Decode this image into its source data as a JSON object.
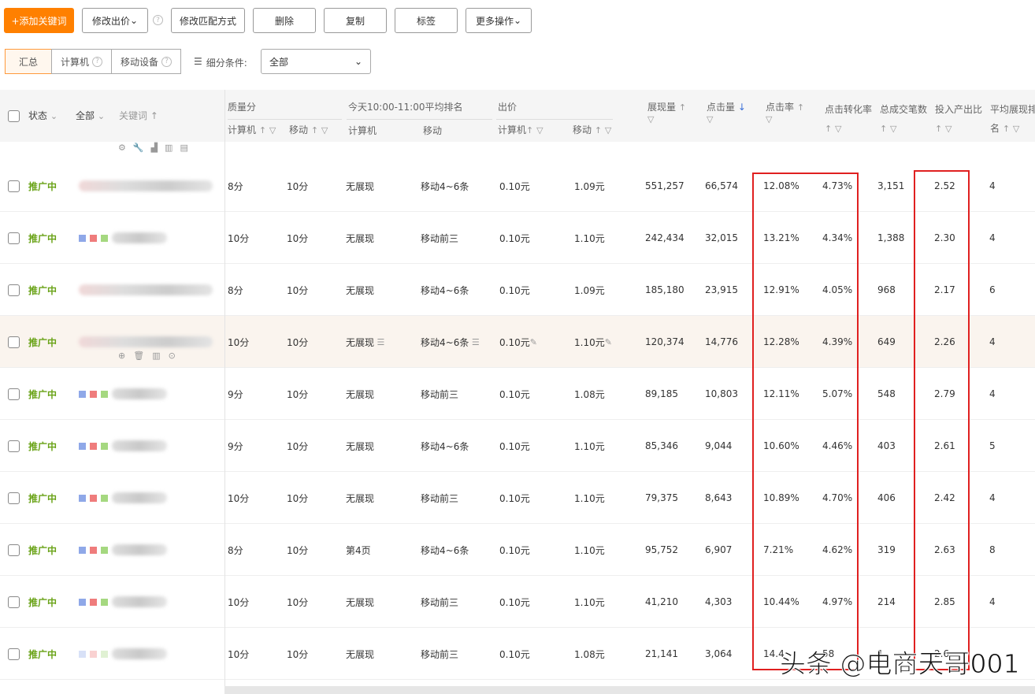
{
  "toolbar": {
    "add": "+添加关键词",
    "edit_bid": "修改出价",
    "edit_match": "修改匹配方式",
    "delete": "删除",
    "copy": "复制",
    "tag": "标签",
    "more": "更多操作"
  },
  "segments": {
    "summary": "汇总",
    "pc": "计算机",
    "mobile": "移动设备",
    "filter_label": "细分条件:",
    "filter_value": "全部"
  },
  "header": {
    "status": "状态",
    "all": "全部",
    "keyword": "关键词",
    "quality": "质量分",
    "qs_pc": "计算机",
    "qs_mobile": "移动",
    "rank": "今天10:00-11:00平均排名",
    "rank_pc": "计算机",
    "rank_mobile": "移动",
    "bid": "出价",
    "bid_pc": "计算机",
    "bid_mobile": "移动",
    "impressions": "展现量",
    "clicks": "点击量",
    "ctr": "点击率",
    "cvr": "点击转化率",
    "orders": "总成交笔数",
    "roi": "投入产出比",
    "avg_rank_1": "平均展现排",
    "avg_rank_2": "名"
  },
  "colors": {
    "accent": "#ff8000",
    "status": "#6aa318",
    "highlight": "#e02020"
  },
  "rows": [
    {
      "status": "推广中",
      "kw": "gray",
      "qs_pc": "8分",
      "qs_m": "10分",
      "rank_pc": "无展现",
      "rank_m": "移动4~6条",
      "bid_pc": "0.10元",
      "bid_m": "1.09元",
      "impr": "551,257",
      "clicks": "66,574",
      "ctr": "12.08%",
      "cvr": "4.73%",
      "orders": "3,151",
      "roi": "2.52",
      "avg": "4"
    },
    {
      "status": "推广中",
      "kw": "color",
      "qs_pc": "10分",
      "qs_m": "10分",
      "rank_pc": "无展现",
      "rank_m": "移动前三",
      "bid_pc": "0.10元",
      "bid_m": "1.10元",
      "impr": "242,434",
      "clicks": "32,015",
      "ctr": "13.21%",
      "cvr": "4.34%",
      "orders": "1,388",
      "roi": "2.30",
      "avg": "4"
    },
    {
      "status": "推广中",
      "kw": "gray",
      "qs_pc": "8分",
      "qs_m": "10分",
      "rank_pc": "无展现",
      "rank_m": "移动4~6条",
      "bid_pc": "0.10元",
      "bid_m": "1.09元",
      "impr": "185,180",
      "clicks": "23,915",
      "ctr": "12.91%",
      "cvr": "4.05%",
      "orders": "968",
      "roi": "2.17",
      "avg": "6"
    },
    {
      "status": "推广中",
      "kw": "gray",
      "hover": true,
      "qs_pc": "10分",
      "qs_m": "10分",
      "rank_pc": "无展现",
      "rank_m": "移动4~6条",
      "bid_pc": "0.10元",
      "bid_m": "1.10元",
      "impr": "120,374",
      "clicks": "14,776",
      "ctr": "12.28%",
      "cvr": "4.39%",
      "orders": "649",
      "roi": "2.26",
      "avg": "4"
    },
    {
      "status": "推广中",
      "kw": "color",
      "qs_pc": "9分",
      "qs_m": "10分",
      "rank_pc": "无展现",
      "rank_m": "移动前三",
      "bid_pc": "0.10元",
      "bid_m": "1.08元",
      "impr": "89,185",
      "clicks": "10,803",
      "ctr": "12.11%",
      "cvr": "5.07%",
      "orders": "548",
      "roi": "2.79",
      "avg": "4"
    },
    {
      "status": "推广中",
      "kw": "color",
      "qs_pc": "9分",
      "qs_m": "10分",
      "rank_pc": "无展现",
      "rank_m": "移动4~6条",
      "bid_pc": "0.10元",
      "bid_m": "1.10元",
      "impr": "85,346",
      "clicks": "9,044",
      "ctr": "10.60%",
      "cvr": "4.46%",
      "orders": "403",
      "roi": "2.61",
      "avg": "5"
    },
    {
      "status": "推广中",
      "kw": "color",
      "qs_pc": "10分",
      "qs_m": "10分",
      "rank_pc": "无展现",
      "rank_m": "移动前三",
      "bid_pc": "0.10元",
      "bid_m": "1.10元",
      "impr": "79,375",
      "clicks": "8,643",
      "ctr": "10.89%",
      "cvr": "4.70%",
      "orders": "406",
      "roi": "2.42",
      "avg": "4"
    },
    {
      "status": "推广中",
      "kw": "color",
      "qs_pc": "8分",
      "qs_m": "10分",
      "rank_pc": "第4页",
      "rank_m": "移动4~6条",
      "bid_pc": "0.10元",
      "bid_m": "1.10元",
      "impr": "95,752",
      "clicks": "6,907",
      "ctr": "7.21%",
      "cvr": "4.62%",
      "orders": "319",
      "roi": "2.63",
      "avg": "8"
    },
    {
      "status": "推广中",
      "kw": "color",
      "qs_pc": "10分",
      "qs_m": "10分",
      "rank_pc": "无展现",
      "rank_m": "移动前三",
      "bid_pc": "0.10元",
      "bid_m": "1.10元",
      "impr": "41,210",
      "clicks": "4,303",
      "ctr": "10.44%",
      "cvr": "4.97%",
      "orders": "214",
      "roi": "2.85",
      "avg": "4"
    },
    {
      "status": "推广中",
      "kw": "lightcolor",
      "qs_pc": "10分",
      "qs_m": "10分",
      "rank_pc": "无展现",
      "rank_m": "移动前三",
      "bid_pc": "0.10元",
      "bid_m": "1.08元",
      "impr": "21,141",
      "clicks": "3,064",
      "ctr": "14.4",
      "cvr": "58",
      "orders": "1",
      "roi": "2.6",
      "avg": ""
    }
  ],
  "watermark": "头条 @电商天哥001"
}
